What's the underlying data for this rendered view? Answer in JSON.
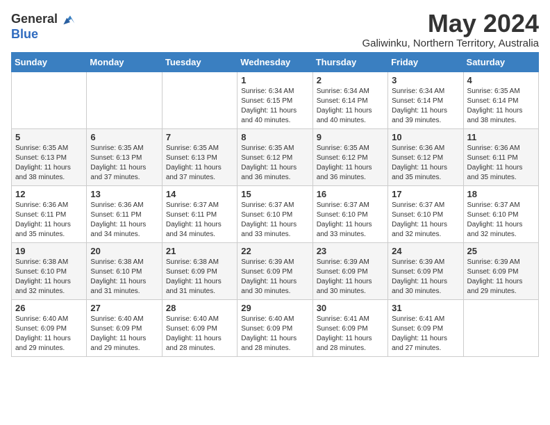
{
  "header": {
    "logo_line1": "General",
    "logo_line2": "Blue",
    "month": "May 2024",
    "location": "Galiwinku, Northern Territory, Australia"
  },
  "weekdays": [
    "Sunday",
    "Monday",
    "Tuesday",
    "Wednesday",
    "Thursday",
    "Friday",
    "Saturday"
  ],
  "weeks": [
    [
      {
        "day": "",
        "sunrise": "",
        "sunset": "",
        "daylight": ""
      },
      {
        "day": "",
        "sunrise": "",
        "sunset": "",
        "daylight": ""
      },
      {
        "day": "",
        "sunrise": "",
        "sunset": "",
        "daylight": ""
      },
      {
        "day": "1",
        "sunrise": "Sunrise: 6:34 AM",
        "sunset": "Sunset: 6:15 PM",
        "daylight": "Daylight: 11 hours and 40 minutes."
      },
      {
        "day": "2",
        "sunrise": "Sunrise: 6:34 AM",
        "sunset": "Sunset: 6:14 PM",
        "daylight": "Daylight: 11 hours and 40 minutes."
      },
      {
        "day": "3",
        "sunrise": "Sunrise: 6:34 AM",
        "sunset": "Sunset: 6:14 PM",
        "daylight": "Daylight: 11 hours and 39 minutes."
      },
      {
        "day": "4",
        "sunrise": "Sunrise: 6:35 AM",
        "sunset": "Sunset: 6:14 PM",
        "daylight": "Daylight: 11 hours and 38 minutes."
      }
    ],
    [
      {
        "day": "5",
        "sunrise": "Sunrise: 6:35 AM",
        "sunset": "Sunset: 6:13 PM",
        "daylight": "Daylight: 11 hours and 38 minutes."
      },
      {
        "day": "6",
        "sunrise": "Sunrise: 6:35 AM",
        "sunset": "Sunset: 6:13 PM",
        "daylight": "Daylight: 11 hours and 37 minutes."
      },
      {
        "day": "7",
        "sunrise": "Sunrise: 6:35 AM",
        "sunset": "Sunset: 6:13 PM",
        "daylight": "Daylight: 11 hours and 37 minutes."
      },
      {
        "day": "8",
        "sunrise": "Sunrise: 6:35 AM",
        "sunset": "Sunset: 6:12 PM",
        "daylight": "Daylight: 11 hours and 36 minutes."
      },
      {
        "day": "9",
        "sunrise": "Sunrise: 6:35 AM",
        "sunset": "Sunset: 6:12 PM",
        "daylight": "Daylight: 11 hours and 36 minutes."
      },
      {
        "day": "10",
        "sunrise": "Sunrise: 6:36 AM",
        "sunset": "Sunset: 6:12 PM",
        "daylight": "Daylight: 11 hours and 35 minutes."
      },
      {
        "day": "11",
        "sunrise": "Sunrise: 6:36 AM",
        "sunset": "Sunset: 6:11 PM",
        "daylight": "Daylight: 11 hours and 35 minutes."
      }
    ],
    [
      {
        "day": "12",
        "sunrise": "Sunrise: 6:36 AM",
        "sunset": "Sunset: 6:11 PM",
        "daylight": "Daylight: 11 hours and 35 minutes."
      },
      {
        "day": "13",
        "sunrise": "Sunrise: 6:36 AM",
        "sunset": "Sunset: 6:11 PM",
        "daylight": "Daylight: 11 hours and 34 minutes."
      },
      {
        "day": "14",
        "sunrise": "Sunrise: 6:37 AM",
        "sunset": "Sunset: 6:11 PM",
        "daylight": "Daylight: 11 hours and 34 minutes."
      },
      {
        "day": "15",
        "sunrise": "Sunrise: 6:37 AM",
        "sunset": "Sunset: 6:10 PM",
        "daylight": "Daylight: 11 hours and 33 minutes."
      },
      {
        "day": "16",
        "sunrise": "Sunrise: 6:37 AM",
        "sunset": "Sunset: 6:10 PM",
        "daylight": "Daylight: 11 hours and 33 minutes."
      },
      {
        "day": "17",
        "sunrise": "Sunrise: 6:37 AM",
        "sunset": "Sunset: 6:10 PM",
        "daylight": "Daylight: 11 hours and 32 minutes."
      },
      {
        "day": "18",
        "sunrise": "Sunrise: 6:37 AM",
        "sunset": "Sunset: 6:10 PM",
        "daylight": "Daylight: 11 hours and 32 minutes."
      }
    ],
    [
      {
        "day": "19",
        "sunrise": "Sunrise: 6:38 AM",
        "sunset": "Sunset: 6:10 PM",
        "daylight": "Daylight: 11 hours and 32 minutes."
      },
      {
        "day": "20",
        "sunrise": "Sunrise: 6:38 AM",
        "sunset": "Sunset: 6:10 PM",
        "daylight": "Daylight: 11 hours and 31 minutes."
      },
      {
        "day": "21",
        "sunrise": "Sunrise: 6:38 AM",
        "sunset": "Sunset: 6:09 PM",
        "daylight": "Daylight: 11 hours and 31 minutes."
      },
      {
        "day": "22",
        "sunrise": "Sunrise: 6:39 AM",
        "sunset": "Sunset: 6:09 PM",
        "daylight": "Daylight: 11 hours and 30 minutes."
      },
      {
        "day": "23",
        "sunrise": "Sunrise: 6:39 AM",
        "sunset": "Sunset: 6:09 PM",
        "daylight": "Daylight: 11 hours and 30 minutes."
      },
      {
        "day": "24",
        "sunrise": "Sunrise: 6:39 AM",
        "sunset": "Sunset: 6:09 PM",
        "daylight": "Daylight: 11 hours and 30 minutes."
      },
      {
        "day": "25",
        "sunrise": "Sunrise: 6:39 AM",
        "sunset": "Sunset: 6:09 PM",
        "daylight": "Daylight: 11 hours and 29 minutes."
      }
    ],
    [
      {
        "day": "26",
        "sunrise": "Sunrise: 6:40 AM",
        "sunset": "Sunset: 6:09 PM",
        "daylight": "Daylight: 11 hours and 29 minutes."
      },
      {
        "day": "27",
        "sunrise": "Sunrise: 6:40 AM",
        "sunset": "Sunset: 6:09 PM",
        "daylight": "Daylight: 11 hours and 29 minutes."
      },
      {
        "day": "28",
        "sunrise": "Sunrise: 6:40 AM",
        "sunset": "Sunset: 6:09 PM",
        "daylight": "Daylight: 11 hours and 28 minutes."
      },
      {
        "day": "29",
        "sunrise": "Sunrise: 6:40 AM",
        "sunset": "Sunset: 6:09 PM",
        "daylight": "Daylight: 11 hours and 28 minutes."
      },
      {
        "day": "30",
        "sunrise": "Sunrise: 6:41 AM",
        "sunset": "Sunset: 6:09 PM",
        "daylight": "Daylight: 11 hours and 28 minutes."
      },
      {
        "day": "31",
        "sunrise": "Sunrise: 6:41 AM",
        "sunset": "Sunset: 6:09 PM",
        "daylight": "Daylight: 11 hours and 27 minutes."
      },
      {
        "day": "",
        "sunrise": "",
        "sunset": "",
        "daylight": ""
      }
    ]
  ]
}
